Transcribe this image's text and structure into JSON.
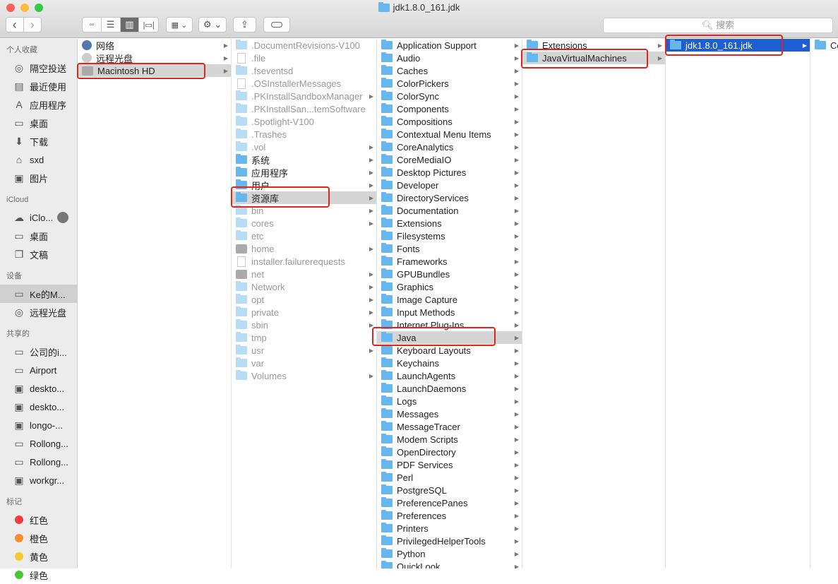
{
  "window": {
    "title": "jdk1.8.0_161.jdk",
    "traffic_lights": [
      "#fc605c",
      "#fdbc40",
      "#34c84a"
    ]
  },
  "toolbar": {
    "back": "‹",
    "forward": "›",
    "search_placeholder": "搜索",
    "view_modes": [
      "icon",
      "list",
      "column",
      "cover-flow"
    ],
    "active_view": "column"
  },
  "sidebar": {
    "sections": [
      {
        "title": "个人收藏",
        "items": [
          {
            "label": "隔空投送",
            "icon": "airdrop-icon"
          },
          {
            "label": "最近使用",
            "icon": "recents-icon"
          },
          {
            "label": "应用程序",
            "icon": "applications-icon"
          },
          {
            "label": "桌面",
            "icon": "desktop-icon"
          },
          {
            "label": "下载",
            "icon": "downloads-icon"
          },
          {
            "label": "sxd",
            "icon": "home-icon"
          },
          {
            "label": "图片",
            "icon": "pictures-icon"
          }
        ]
      },
      {
        "title": "iCloud",
        "items": [
          {
            "label": "iClo...",
            "icon": "cloud-icon"
          },
          {
            "label": "桌面",
            "icon": "desktop-icon"
          },
          {
            "label": "文稿",
            "icon": "documents-icon"
          }
        ]
      },
      {
        "title": "设备",
        "items": [
          {
            "label": "Ke的M...",
            "icon": "laptop-icon",
            "selected": true
          },
          {
            "label": "远程光盘",
            "icon": "disc-icon"
          }
        ]
      },
      {
        "title": "共享的",
        "items": [
          {
            "label": "公司的i...",
            "icon": "imac-icon"
          },
          {
            "label": "Airport",
            "icon": "imac-icon"
          },
          {
            "label": "deskto...",
            "icon": "pc-icon"
          },
          {
            "label": "deskto...",
            "icon": "pc-icon"
          },
          {
            "label": "longo-...",
            "icon": "pc-icon"
          },
          {
            "label": "Rollong...",
            "icon": "imac-icon"
          },
          {
            "label": "Rollong...",
            "icon": "imac-icon"
          },
          {
            "label": "workgr...",
            "icon": "pc-icon"
          }
        ]
      },
      {
        "title": "标记",
        "items": [
          {
            "label": "红色",
            "color": "#f23d3d"
          },
          {
            "label": "橙色",
            "color": "#f7902c"
          },
          {
            "label": "黄色",
            "color": "#f7cb2d"
          },
          {
            "label": "绿色",
            "color": "#4bc43b"
          }
        ]
      }
    ]
  },
  "columns": [
    {
      "items": [
        {
          "label": "网络",
          "icon": "network-icon",
          "arrow": true
        },
        {
          "label": "远程光盘",
          "icon": "disc-icon",
          "arrow": true
        },
        {
          "label": "Macintosh HD",
          "icon": "disk-icon",
          "arrow": true,
          "state": "sel"
        }
      ]
    },
    {
      "items": [
        {
          "label": ".DocumentRevisions-V100",
          "icon": "folder",
          "dim": true
        },
        {
          "label": ".file",
          "icon": "doc",
          "dim": true
        },
        {
          "label": ".fseventsd",
          "icon": "folder",
          "dim": true
        },
        {
          "label": ".OSInstallerMessages",
          "icon": "doc",
          "dim": true
        },
        {
          "label": ".PKInstallSandboxManager",
          "icon": "folder",
          "dim": true,
          "arrow": true
        },
        {
          "label": ".PKInstallSan...temSoftware",
          "icon": "folder",
          "dim": true
        },
        {
          "label": ".Spotlight-V100",
          "icon": "folder",
          "dim": true
        },
        {
          "label": ".Trashes",
          "icon": "folder",
          "dim": true
        },
        {
          "label": ".vol",
          "icon": "folder",
          "dim": true,
          "arrow": true
        },
        {
          "label": "系统",
          "icon": "folder",
          "arrow": true
        },
        {
          "label": "应用程序",
          "icon": "folder",
          "arrow": true
        },
        {
          "label": "用户",
          "icon": "folder",
          "arrow": true
        },
        {
          "label": "资源库",
          "icon": "folder",
          "arrow": true,
          "state": "sel"
        },
        {
          "label": "bin",
          "icon": "folder",
          "dim": true,
          "arrow": true
        },
        {
          "label": "cores",
          "icon": "folder",
          "dim": true,
          "arrow": true
        },
        {
          "label": "etc",
          "icon": "folder",
          "dim": true
        },
        {
          "label": "home",
          "icon": "disk",
          "dim": true,
          "arrow": true
        },
        {
          "label": "installer.failurerequests",
          "icon": "doc",
          "dim": true
        },
        {
          "label": "net",
          "icon": "disk",
          "dim": true,
          "arrow": true
        },
        {
          "label": "Network",
          "icon": "folder",
          "dim": true,
          "arrow": true
        },
        {
          "label": "opt",
          "icon": "folder",
          "dim": true,
          "arrow": true
        },
        {
          "label": "private",
          "icon": "folder",
          "dim": true,
          "arrow": true
        },
        {
          "label": "sbin",
          "icon": "folder",
          "dim": true,
          "arrow": true
        },
        {
          "label": "tmp",
          "icon": "folder",
          "dim": true
        },
        {
          "label": "usr",
          "icon": "folder",
          "dim": true,
          "arrow": true
        },
        {
          "label": "var",
          "icon": "folder",
          "dim": true
        },
        {
          "label": "Volumes",
          "icon": "folder",
          "dim": true,
          "arrow": true
        }
      ]
    },
    {
      "items": [
        {
          "label": "Application Support"
        },
        {
          "label": "Audio"
        },
        {
          "label": "Caches"
        },
        {
          "label": "ColorPickers"
        },
        {
          "label": "ColorSync"
        },
        {
          "label": "Components"
        },
        {
          "label": "Compositions"
        },
        {
          "label": "Contextual Menu Items"
        },
        {
          "label": "CoreAnalytics"
        },
        {
          "label": "CoreMediaIO"
        },
        {
          "label": "Desktop Pictures"
        },
        {
          "label": "Developer"
        },
        {
          "label": "DirectoryServices"
        },
        {
          "label": "Documentation"
        },
        {
          "label": "Extensions"
        },
        {
          "label": "Filesystems"
        },
        {
          "label": "Fonts"
        },
        {
          "label": "Frameworks"
        },
        {
          "label": "GPUBundles"
        },
        {
          "label": "Graphics"
        },
        {
          "label": "Image Capture"
        },
        {
          "label": "Input Methods"
        },
        {
          "label": "Internet Plug-Ins"
        },
        {
          "label": "Java",
          "state": "sel"
        },
        {
          "label": "Keyboard Layouts"
        },
        {
          "label": "Keychains"
        },
        {
          "label": "LaunchAgents"
        },
        {
          "label": "LaunchDaemons"
        },
        {
          "label": "Logs"
        },
        {
          "label": "Messages"
        },
        {
          "label": "MessageTracer"
        },
        {
          "label": "Modem Scripts"
        },
        {
          "label": "OpenDirectory"
        },
        {
          "label": "PDF Services"
        },
        {
          "label": "Perl"
        },
        {
          "label": "PostgreSQL"
        },
        {
          "label": "PreferencePanes"
        },
        {
          "label": "Preferences"
        },
        {
          "label": "Printers"
        },
        {
          "label": "PrivilegedHelperTools"
        },
        {
          "label": "Python"
        },
        {
          "label": "QuickLook"
        }
      ]
    },
    {
      "items": [
        {
          "label": "Extensions",
          "arrow": true
        },
        {
          "label": "JavaVirtualMachines",
          "arrow": true,
          "state": "sel"
        }
      ]
    },
    {
      "items": [
        {
          "label": "jdk1.8.0_161.jdk",
          "arrow": true,
          "state": "act"
        }
      ]
    },
    {
      "items": [
        {
          "label": "Co"
        }
      ]
    }
  ]
}
